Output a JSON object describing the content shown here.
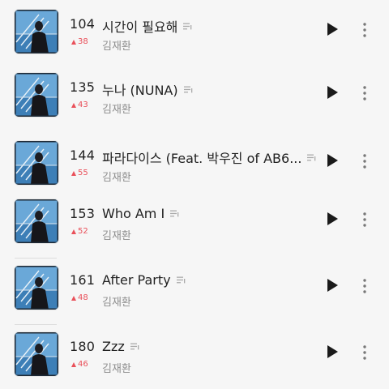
{
  "songs": [
    {
      "rank": "104",
      "change": "38",
      "title": "시간이 필요해",
      "artist": "김재환"
    },
    {
      "rank": "135",
      "change": "43",
      "title": "누나 (NUNA)",
      "artist": "김재환"
    },
    {
      "rank": "144",
      "change": "55",
      "title": "파라다이스 (Feat. 박우진 of AB6...",
      "artist": "김재환"
    },
    {
      "rank": "153",
      "change": "52",
      "title": "Who Am I",
      "artist": "김재환"
    },
    {
      "rank": "161",
      "change": "48",
      "title": "After Party",
      "artist": "김재환"
    },
    {
      "rank": "180",
      "change": "46",
      "title": "Zzz",
      "artist": "김재환"
    }
  ],
  "icons": {
    "play": "play-icon",
    "more": "more-vertical-icon",
    "lyrics": "lyrics-icon",
    "rank_up": "rank-up-triangle-icon"
  },
  "colors": {
    "rank_up": "#e9505a",
    "background": "#f6f6f6",
    "artist_text": "#8d8d8d"
  }
}
